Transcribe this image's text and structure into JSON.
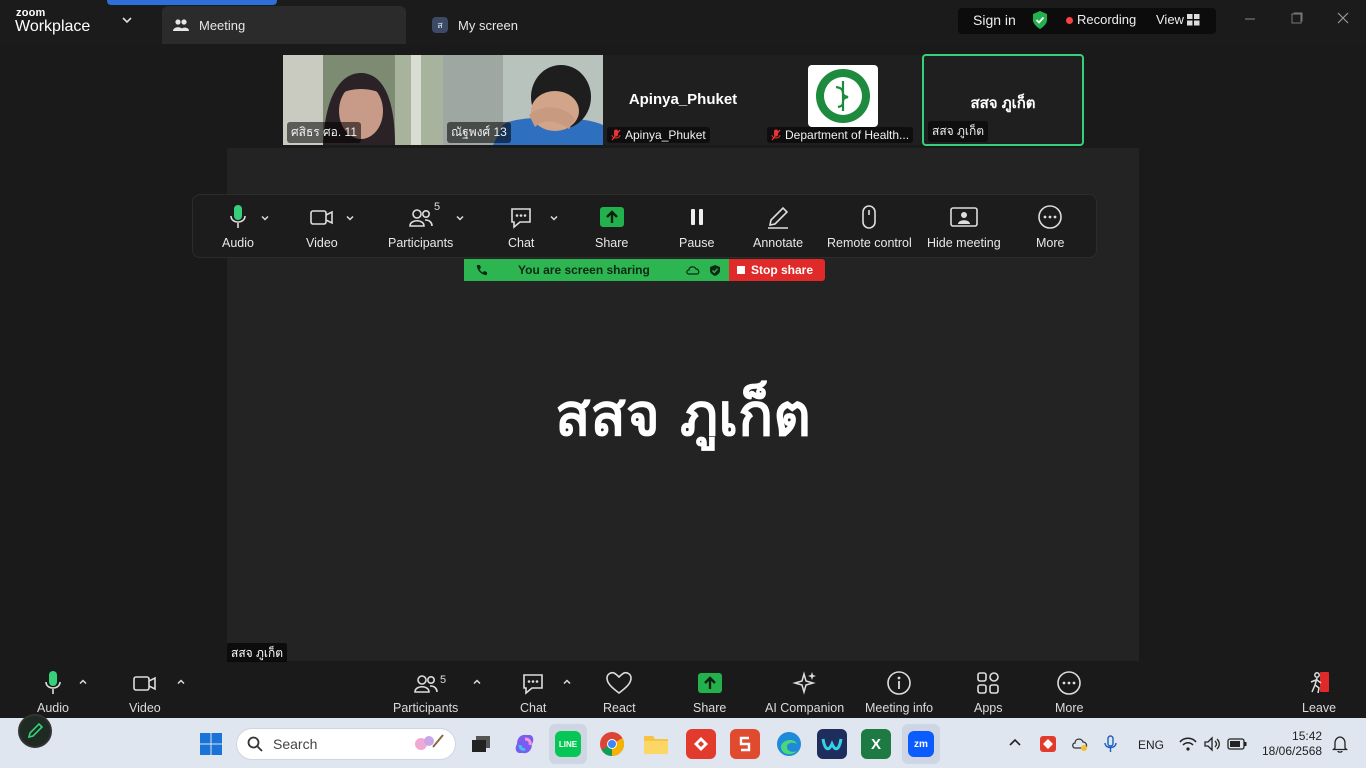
{
  "titlebar": {
    "logo_top": "zoom",
    "logo_bottom": "Workplace",
    "tabs": [
      {
        "label": "Meeting",
        "icon": "people-icon"
      },
      {
        "label": "My screen",
        "badge": "ส"
      }
    ],
    "sign_in": "Sign in",
    "recording": "Recording",
    "view": "View"
  },
  "thumbnails": [
    {
      "name": "ศสิธร ศอ. 11",
      "type": "video"
    },
    {
      "name": "ณัฐพงศ์ 13",
      "type": "video"
    },
    {
      "name": "Apinya_Phuket",
      "display": "Apinya_Phuket",
      "muted": true
    },
    {
      "name": "Department of Health...",
      "muted": true,
      "logo": "department-of-health-logo"
    },
    {
      "name": "สสจ ภูเก็ต",
      "display": "สสจ ภูเก็ต",
      "active": true
    }
  ],
  "share": {
    "big_text": "สสจ ภูเก็ต",
    "label": "สสจ ภูเก็ต",
    "sharing_text": "You are screen sharing",
    "stop_share": "Stop share"
  },
  "float_toolbar": {
    "audio": "Audio",
    "video": "Video",
    "participants": "Participants",
    "participants_count": "5",
    "chat": "Chat",
    "share": "Share",
    "pause": "Pause",
    "annotate": "Annotate",
    "remote_control": "Remote control",
    "hide_meeting": "Hide meeting",
    "more": "More"
  },
  "bottom_toolbar": {
    "audio": "Audio",
    "video": "Video",
    "participants": "Participants",
    "participants_count": "5",
    "chat": "Chat",
    "react": "React",
    "share": "Share",
    "ai_companion": "AI Companion",
    "meeting_info": "Meeting info",
    "apps": "Apps",
    "more": "More",
    "leave": "Leave"
  },
  "taskbar": {
    "search_placeholder": "Search",
    "language": "ENG",
    "time": "15:42",
    "date": "18/06/2568"
  },
  "colors": {
    "accent_green": "#2db551",
    "stop_red": "#e02a2a",
    "zoom_blue": "#2d6fd6"
  }
}
